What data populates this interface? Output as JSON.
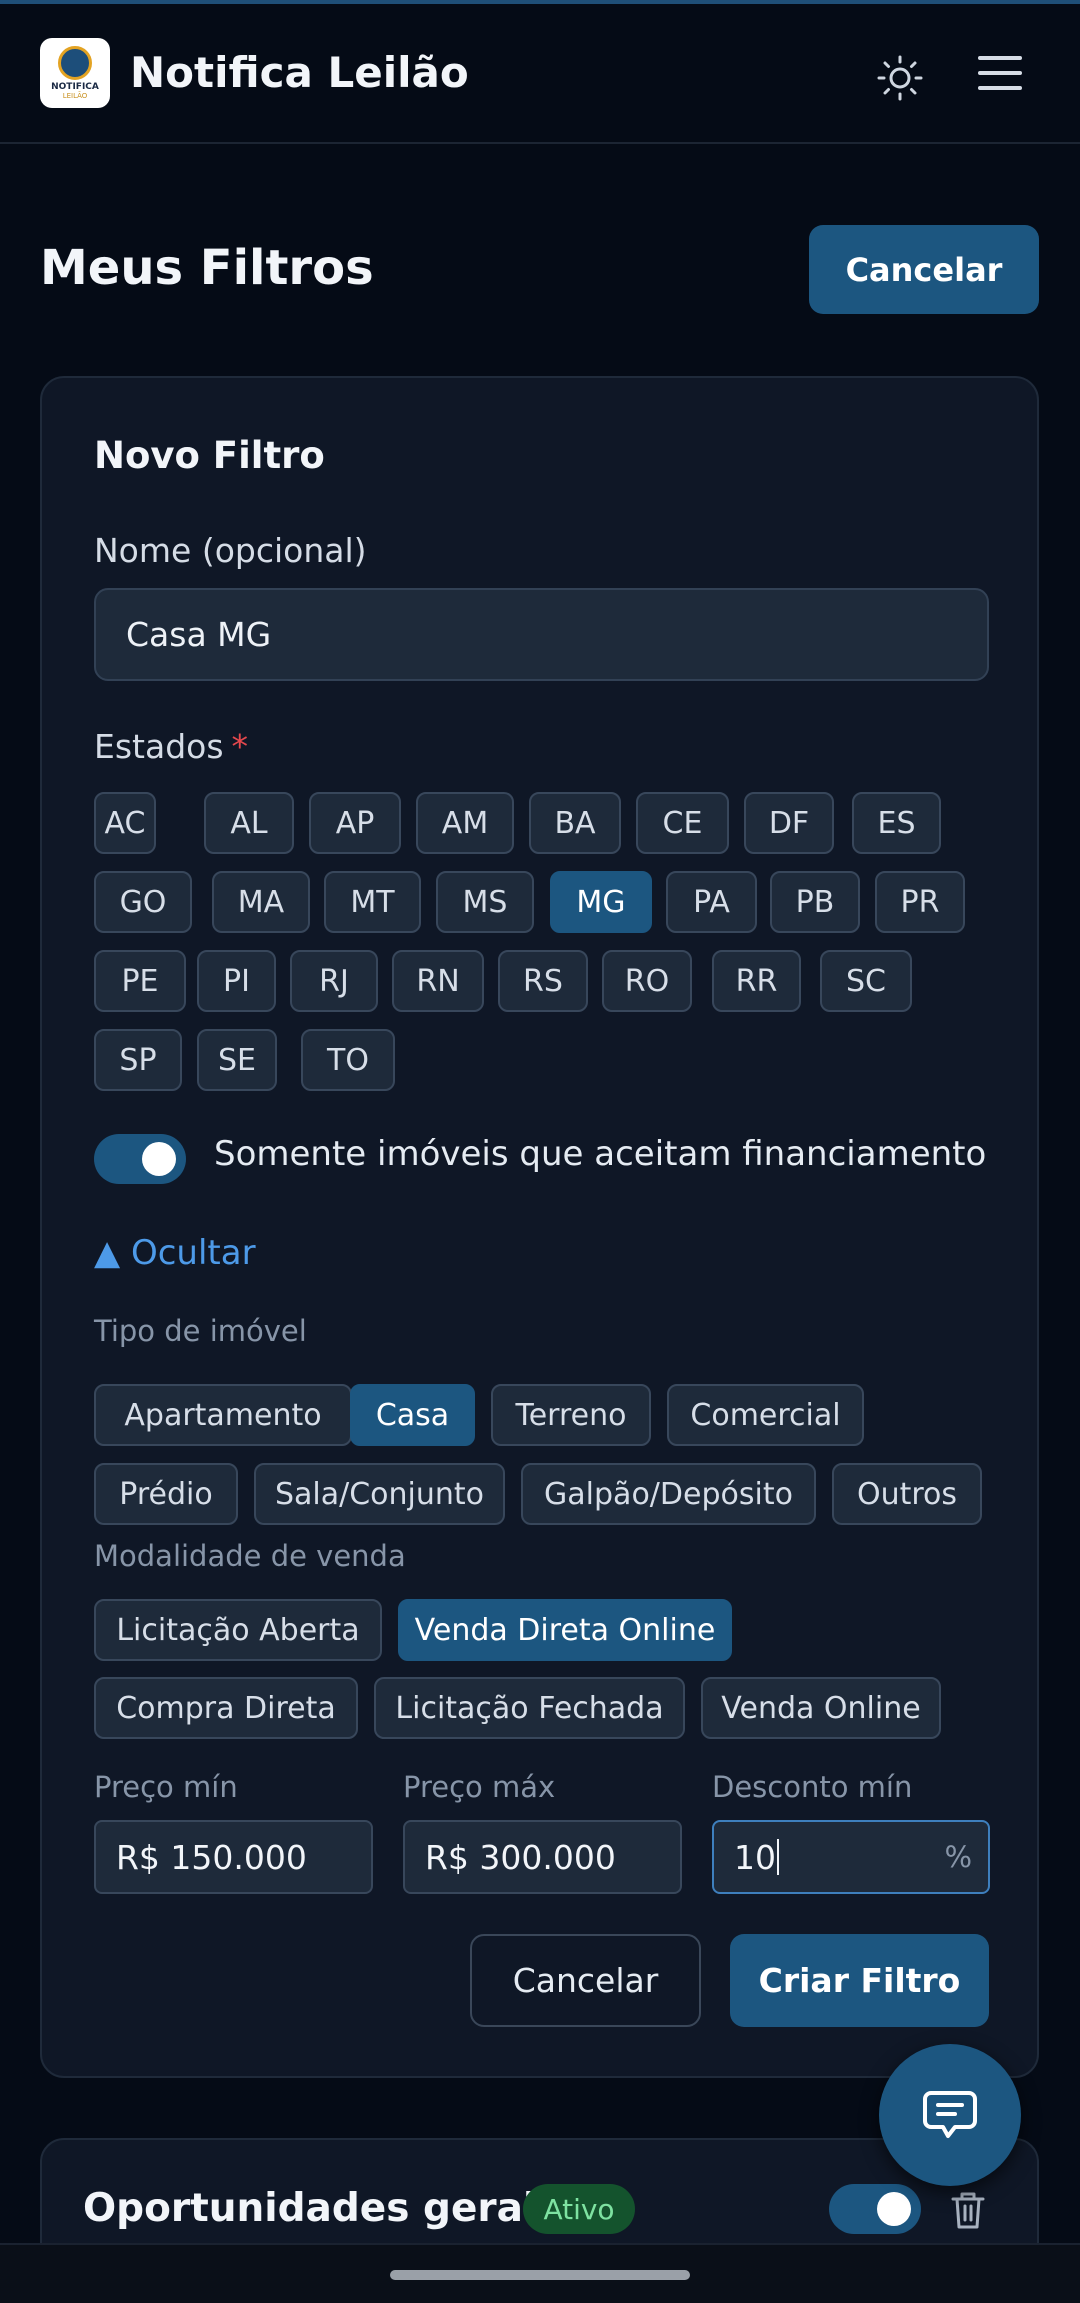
{
  "header": {
    "title": "Notifica Leilão",
    "logo_line1": "NOTIFICA",
    "logo_line2": "LEILÃO",
    "theme_icon": "sun-icon",
    "menu_icon": "hamburger-menu-icon"
  },
  "page": {
    "title": "Meus Filtros",
    "cancel_label": "Cancelar"
  },
  "form": {
    "title": "Novo Filtro",
    "name_label": "Nome (opcional)",
    "name_value": "Casa MG",
    "states_label": "Estados",
    "required_mark": "*",
    "states": [
      "AC",
      "AL",
      "AP",
      "AM",
      "BA",
      "CE",
      "DF",
      "ES",
      "GO",
      "MA",
      "MT",
      "MS",
      "MG",
      "PA",
      "PB",
      "PR",
      "PE",
      "PI",
      "RJ",
      "RN",
      "RS",
      "RO",
      "RR",
      "SC",
      "SP",
      "SE",
      "TO"
    ],
    "selected_state": "MG",
    "financing_toggle": {
      "label": "Somente imóveis que aceitam financiamento",
      "on": true
    },
    "hide_label": "▲ Ocultar",
    "property_type_label": "Tipo de imóvel",
    "property_types": [
      "Apartamento",
      "Casa",
      "Terreno",
      "Comercial",
      "Prédio",
      "Sala/Conjunto",
      "Galpão/Depósito",
      "Outros"
    ],
    "selected_property_type": "Casa",
    "sale_mode_label": "Modalidade de venda",
    "sale_modes": [
      "Licitação Aberta",
      "Venda Direta Online",
      "Compra Direta",
      "Licitação Fechada",
      "Venda Online"
    ],
    "selected_sale_mode": "Venda Direta Online",
    "price_min_label": "Preço mín",
    "price_min_value": "R$ 150.000",
    "price_max_label": "Preço máx",
    "price_max_value": "R$ 300.000",
    "discount_label": "Desconto mín",
    "discount_value": "10",
    "discount_unit": "%",
    "cancel_label": "Cancelar",
    "submit_label": "Criar Filtro"
  },
  "existing_filter": {
    "title": "Oportunidades gerais",
    "status": "Ativo",
    "active": true,
    "delete_icon": "trash-icon"
  },
  "fab": {
    "icon": "chat-icon"
  },
  "colors": {
    "background": "#050b16",
    "card": "#0f1726",
    "accent": "#1c5680",
    "link": "#4d9ae8",
    "active_badge": "#14532d"
  }
}
